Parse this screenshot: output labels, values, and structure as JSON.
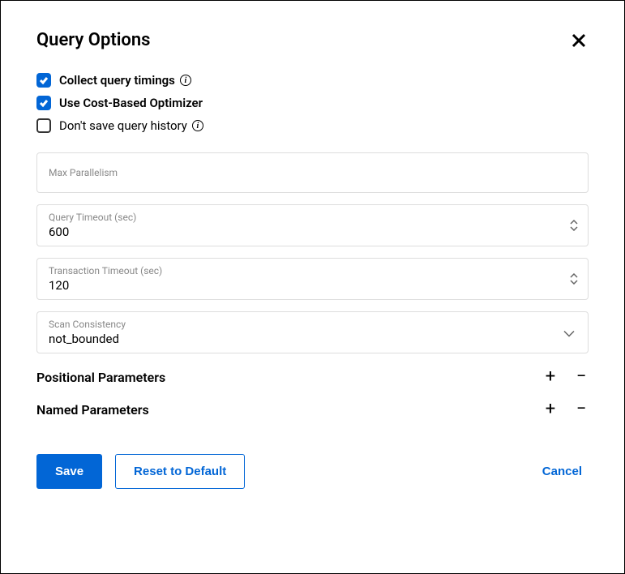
{
  "header": {
    "title": "Query Options"
  },
  "checkboxes": {
    "collect_timings": {
      "label": "Collect query timings",
      "checked": true,
      "info": true
    },
    "use_cbo": {
      "label": "Use Cost-Based Optimizer",
      "checked": true,
      "info": false
    },
    "dont_save_history": {
      "label": "Don't save query history",
      "checked": false,
      "info": true
    }
  },
  "fields": {
    "max_parallelism": {
      "label": "Max Parallelism",
      "value": ""
    },
    "query_timeout": {
      "label": "Query Timeout (sec)",
      "value": "600"
    },
    "transaction_timeout": {
      "label": "Transaction Timeout (sec)",
      "value": "120"
    },
    "scan_consistency": {
      "label": "Scan Consistency",
      "value": "not_bounded"
    }
  },
  "params": {
    "positional": {
      "label": "Positional Parameters"
    },
    "named": {
      "label": "Named Parameters"
    }
  },
  "footer": {
    "save": "Save",
    "reset": "Reset to Default",
    "cancel": "Cancel"
  }
}
